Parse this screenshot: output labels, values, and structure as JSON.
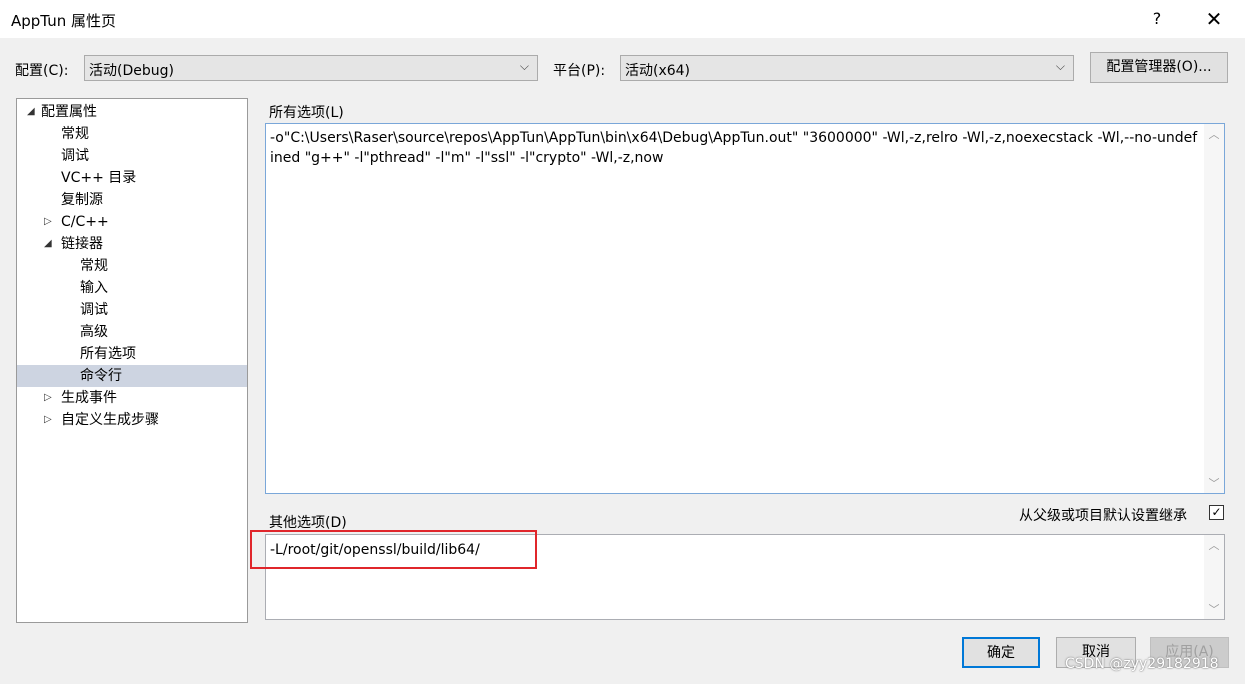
{
  "window": {
    "title": "AppTun 属性页",
    "help": "?",
    "close": "✕"
  },
  "config": {
    "label": "配置(C):",
    "value": "活动(Debug)"
  },
  "platform": {
    "label": "平台(P):",
    "value": "活动(x64)"
  },
  "config_manager": "配置管理器(O)...",
  "tree": [
    {
      "label": "配置属性",
      "twisty": "◢",
      "level": 0
    },
    {
      "label": "常规",
      "twisty": "",
      "level": 1
    },
    {
      "label": "调试",
      "twisty": "",
      "level": 1
    },
    {
      "label": "VC++ 目录",
      "twisty": "",
      "level": 1
    },
    {
      "label": "复制源",
      "twisty": "",
      "level": 1
    },
    {
      "label": "C/C++",
      "twisty": "▷",
      "level": 1
    },
    {
      "label": "链接器",
      "twisty": "◢",
      "level": 1
    },
    {
      "label": "常规",
      "twisty": "",
      "level": 2
    },
    {
      "label": "输入",
      "twisty": "",
      "level": 2
    },
    {
      "label": "调试",
      "twisty": "",
      "level": 2
    },
    {
      "label": "高级",
      "twisty": "",
      "level": 2
    },
    {
      "label": "所有选项",
      "twisty": "",
      "level": 2
    },
    {
      "label": "命令行",
      "twisty": "",
      "level": 2,
      "selected": true
    },
    {
      "label": "生成事件",
      "twisty": "▷",
      "level": 1
    },
    {
      "label": "自定义生成步骤",
      "twisty": "▷",
      "level": 1
    }
  ],
  "all_options": {
    "label": "所有选项(L)",
    "text": "-o\"C:\\Users\\Raser\\source\\repos\\AppTun\\AppTun\\bin\\x64\\Debug\\AppTun.out\" \"3600000\" -Wl,-z,relro -Wl,-z,noexecstack -Wl,--no-undefined \"g++\" -l\"pthread\" -l\"m\" -l\"ssl\" -l\"crypto\" -Wl,-z,now"
  },
  "other_options": {
    "label": "其他选项(D)",
    "text": "-L/root/git/openssl/build/lib64/"
  },
  "inherit": {
    "label": "从父级或项目默认设置继承",
    "checked": "✓"
  },
  "buttons": {
    "ok": "确定",
    "cancel": "取消",
    "apply": "应用(A)"
  },
  "watermark": "CSDN @zyy29182918"
}
